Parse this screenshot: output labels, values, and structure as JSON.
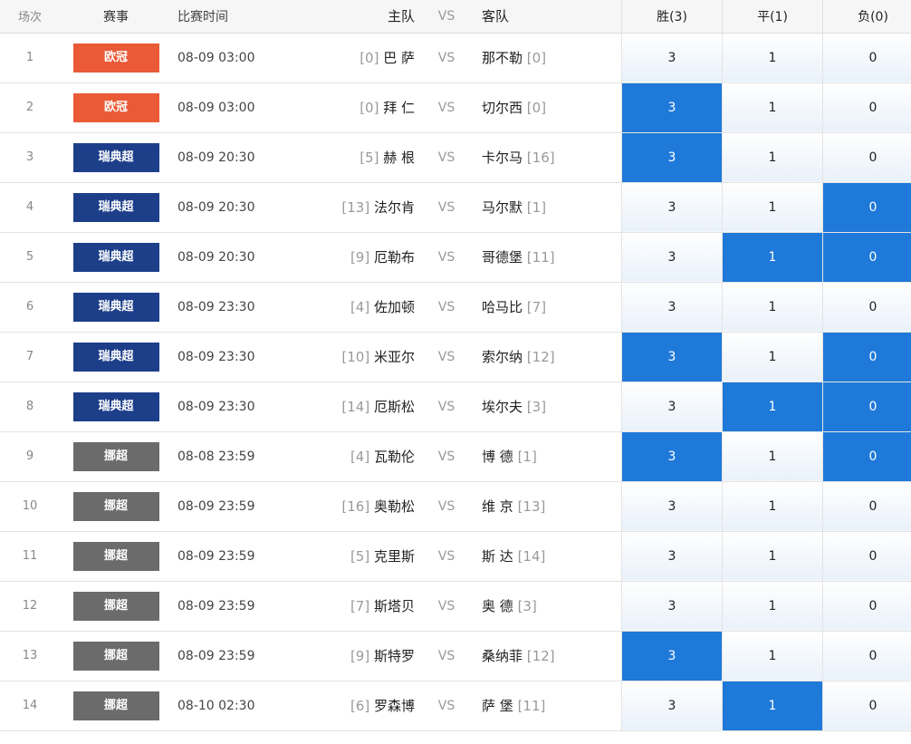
{
  "colors": {
    "ucl": "#ea5a36",
    "swe": "#1d3f8a",
    "nor": "#6b6b6b",
    "selected": "#1f79d9"
  },
  "header": {
    "idx": "场次",
    "league": "赛事",
    "time": "比赛时间",
    "home": "主队",
    "vs": "VS",
    "away": "客队",
    "win": "胜(3)",
    "draw": "平(1)",
    "lose": "负(0)"
  },
  "rows": [
    {
      "idx": "1",
      "league": "欧冠",
      "lc": "ucl",
      "time": "08-09 03:00",
      "hr": "[0]",
      "home": "巴 萨",
      "vs": "VS",
      "away": "那不勒",
      "ar": "[0]",
      "w": "3",
      "d": "1",
      "l": "0",
      "sw": false,
      "sd": false,
      "sl": false
    },
    {
      "idx": "2",
      "league": "欧冠",
      "lc": "ucl",
      "time": "08-09 03:00",
      "hr": "[0]",
      "home": "拜 仁",
      "vs": "VS",
      "away": "切尔西",
      "ar": "[0]",
      "w": "3",
      "d": "1",
      "l": "0",
      "sw": true,
      "sd": false,
      "sl": false
    },
    {
      "idx": "3",
      "league": "瑞典超",
      "lc": "swe",
      "time": "08-09 20:30",
      "hr": "[5]",
      "home": "赫 根",
      "vs": "VS",
      "away": "卡尔马",
      "ar": "[16]",
      "w": "3",
      "d": "1",
      "l": "0",
      "sw": true,
      "sd": false,
      "sl": false
    },
    {
      "idx": "4",
      "league": "瑞典超",
      "lc": "swe",
      "time": "08-09 20:30",
      "hr": "[13]",
      "home": "法尔肯",
      "vs": "VS",
      "away": "马尔默",
      "ar": "[1]",
      "w": "3",
      "d": "1",
      "l": "0",
      "sw": false,
      "sd": false,
      "sl": true
    },
    {
      "idx": "5",
      "league": "瑞典超",
      "lc": "swe",
      "time": "08-09 20:30",
      "hr": "[9]",
      "home": "厄勒布",
      "vs": "VS",
      "away": "哥德堡",
      "ar": "[11]",
      "w": "3",
      "d": "1",
      "l": "0",
      "sw": false,
      "sd": true,
      "sl": true
    },
    {
      "idx": "6",
      "league": "瑞典超",
      "lc": "swe",
      "time": "08-09 23:30",
      "hr": "[4]",
      "home": "佐加顿",
      "vs": "VS",
      "away": "哈马比",
      "ar": "[7]",
      "w": "3",
      "d": "1",
      "l": "0",
      "sw": false,
      "sd": false,
      "sl": false
    },
    {
      "idx": "7",
      "league": "瑞典超",
      "lc": "swe",
      "time": "08-09 23:30",
      "hr": "[10]",
      "home": "米亚尔",
      "vs": "VS",
      "away": "索尔纳",
      "ar": "[12]",
      "w": "3",
      "d": "1",
      "l": "0",
      "sw": true,
      "sd": false,
      "sl": true
    },
    {
      "idx": "8",
      "league": "瑞典超",
      "lc": "swe",
      "time": "08-09 23:30",
      "hr": "[14]",
      "home": "厄斯松",
      "vs": "VS",
      "away": "埃尔夫",
      "ar": "[3]",
      "w": "3",
      "d": "1",
      "l": "0",
      "sw": false,
      "sd": true,
      "sl": true
    },
    {
      "idx": "9",
      "league": "挪超",
      "lc": "nor",
      "time": "08-08 23:59",
      "hr": "[4]",
      "home": "瓦勒伦",
      "vs": "VS",
      "away": "博 德",
      "ar": "[1]",
      "w": "3",
      "d": "1",
      "l": "0",
      "sw": true,
      "sd": false,
      "sl": true
    },
    {
      "idx": "10",
      "league": "挪超",
      "lc": "nor",
      "time": "08-09 23:59",
      "hr": "[16]",
      "home": "奥勒松",
      "vs": "VS",
      "away": "维 京",
      "ar": "[13]",
      "w": "3",
      "d": "1",
      "l": "0",
      "sw": false,
      "sd": false,
      "sl": false
    },
    {
      "idx": "11",
      "league": "挪超",
      "lc": "nor",
      "time": "08-09 23:59",
      "hr": "[5]",
      "home": "克里斯",
      "vs": "VS",
      "away": "斯 达",
      "ar": "[14]",
      "w": "3",
      "d": "1",
      "l": "0",
      "sw": false,
      "sd": false,
      "sl": false
    },
    {
      "idx": "12",
      "league": "挪超",
      "lc": "nor",
      "time": "08-09 23:59",
      "hr": "[7]",
      "home": "斯塔贝",
      "vs": "VS",
      "away": "奥 德",
      "ar": "[3]",
      "w": "3",
      "d": "1",
      "l": "0",
      "sw": false,
      "sd": false,
      "sl": false
    },
    {
      "idx": "13",
      "league": "挪超",
      "lc": "nor",
      "time": "08-09 23:59",
      "hr": "[9]",
      "home": "斯特罗",
      "vs": "VS",
      "away": "桑纳菲",
      "ar": "[12]",
      "w": "3",
      "d": "1",
      "l": "0",
      "sw": true,
      "sd": false,
      "sl": false
    },
    {
      "idx": "14",
      "league": "挪超",
      "lc": "nor",
      "time": "08-10 02:30",
      "hr": "[6]",
      "home": "罗森博",
      "vs": "VS",
      "away": "萨 堡",
      "ar": "[11]",
      "w": "3",
      "d": "1",
      "l": "0",
      "sw": false,
      "sd": true,
      "sl": false
    }
  ]
}
